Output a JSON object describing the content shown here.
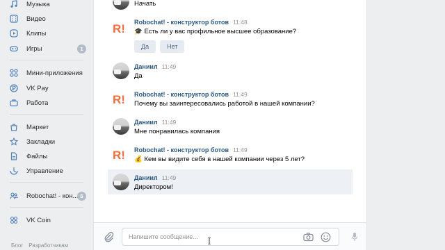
{
  "sidebar": {
    "items": [
      {
        "label": "Музыка",
        "icon": "music-icon"
      },
      {
        "label": "Видео",
        "icon": "video-icon"
      },
      {
        "label": "Клипы",
        "icon": "clips-icon"
      },
      {
        "label": "Игры",
        "icon": "games-icon",
        "badge": "1"
      },
      {
        "label": "Мини-приложения",
        "icon": "mini-apps-icon"
      },
      {
        "label": "VK Pay",
        "icon": "vk-pay-icon"
      },
      {
        "label": "Работа",
        "icon": "work-icon"
      },
      {
        "label": "Маркет",
        "icon": "market-icon"
      },
      {
        "label": "Закладки",
        "icon": "bookmarks-icon"
      },
      {
        "label": "Файлы",
        "icon": "files-icon"
      },
      {
        "label": "Управление",
        "icon": "manage-icon"
      },
      {
        "label": "Robochat! - кон...",
        "icon": "community-icon",
        "badge": "5"
      },
      {
        "label": "VK Coin",
        "icon": "vk-coin-icon"
      }
    ],
    "footer": [
      "Блог",
      "Разработчикам"
    ]
  },
  "chat": {
    "messages": [
      {
        "author": "",
        "time": "",
        "text": "Начать",
        "kind": "user"
      },
      {
        "author": "Robochat! - конструктор ботов",
        "time": "11:48",
        "text": "🎓 Есть ли у вас профильное высшее образование?",
        "kind": "bot",
        "buttons": [
          "Да",
          "Нет"
        ]
      },
      {
        "author": "Даниил",
        "time": "11:49",
        "text": "Да",
        "kind": "user"
      },
      {
        "author": "Robochat! - конструктор ботов",
        "time": "11:49",
        "text": "Почему вы заинтересовались работой в нашей компании?",
        "kind": "bot"
      },
      {
        "author": "Даниил",
        "time": "11:49",
        "text": "Мне понравилась компания",
        "kind": "user"
      },
      {
        "author": "Robochat! - конструктор ботов",
        "time": "11:49",
        "text": "💰 Кем вы видите себя в нашей компании через 5 лет?",
        "kind": "bot"
      },
      {
        "author": "Даниил",
        "time": "11:49",
        "text": "Директором!",
        "kind": "user"
      }
    ]
  },
  "composer": {
    "placeholder": "Напишите сообщение..."
  },
  "colors": {
    "bot_logo": "#f26d3d",
    "link": "#2a5885",
    "accent": "#5181b8"
  }
}
